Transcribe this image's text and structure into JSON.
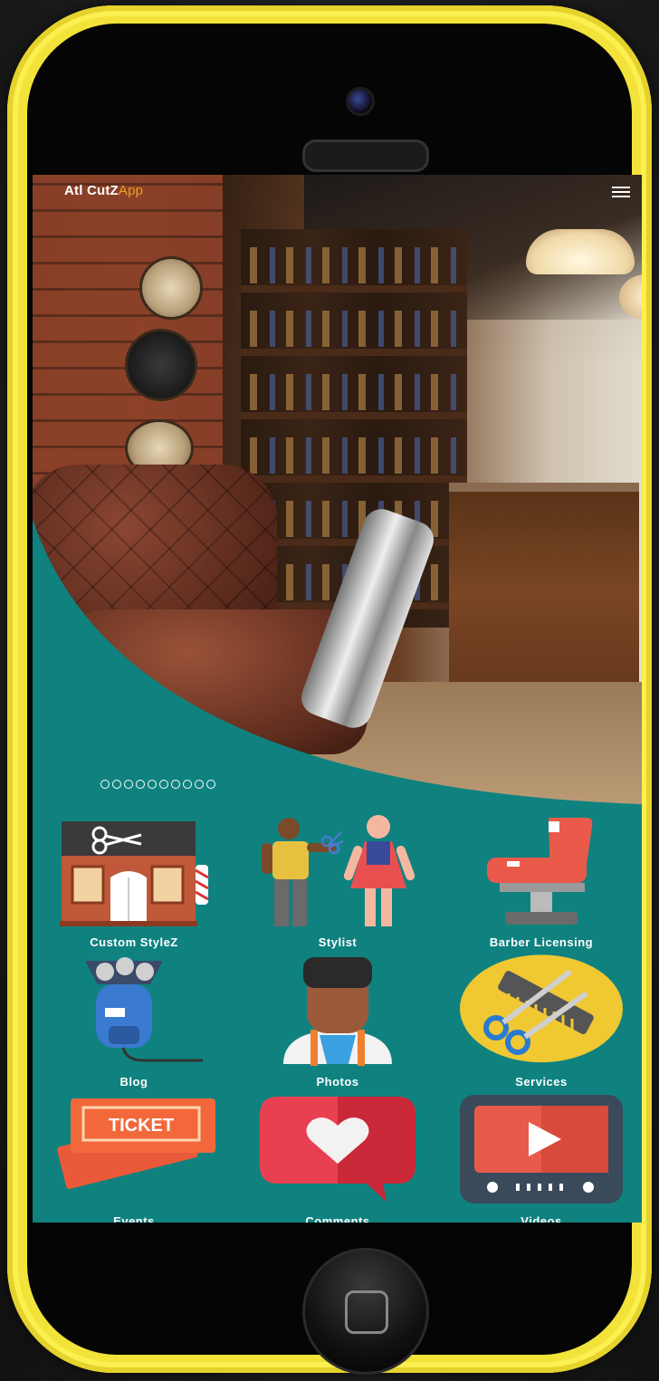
{
  "app": {
    "brand_main": "Atl CutZ",
    "brand_accent": "App",
    "accent_color": "#e8a317",
    "theme_color": "#0f8280"
  },
  "header": {
    "menu_icon": "hamburger-menu-icon"
  },
  "carousel": {
    "slide_count": 10,
    "active_index": 0
  },
  "tiles": [
    {
      "label": "Custom StyleZ",
      "icon": "barbershop-storefront-icon"
    },
    {
      "label": "Stylist",
      "icon": "stylist-couple-icon"
    },
    {
      "label": "Barber Licensing",
      "icon": "barber-chair-icon"
    },
    {
      "label": "Blog",
      "icon": "electric-shaver-icon"
    },
    {
      "label": "Photos",
      "icon": "barber-person-icon"
    },
    {
      "label": "Services",
      "icon": "comb-scissors-icon"
    },
    {
      "label": "Events",
      "icon": "ticket-icon"
    },
    {
      "label": "Comments",
      "icon": "heart-speech-bubble-icon"
    },
    {
      "label": "Videos",
      "icon": "video-player-icon"
    }
  ]
}
